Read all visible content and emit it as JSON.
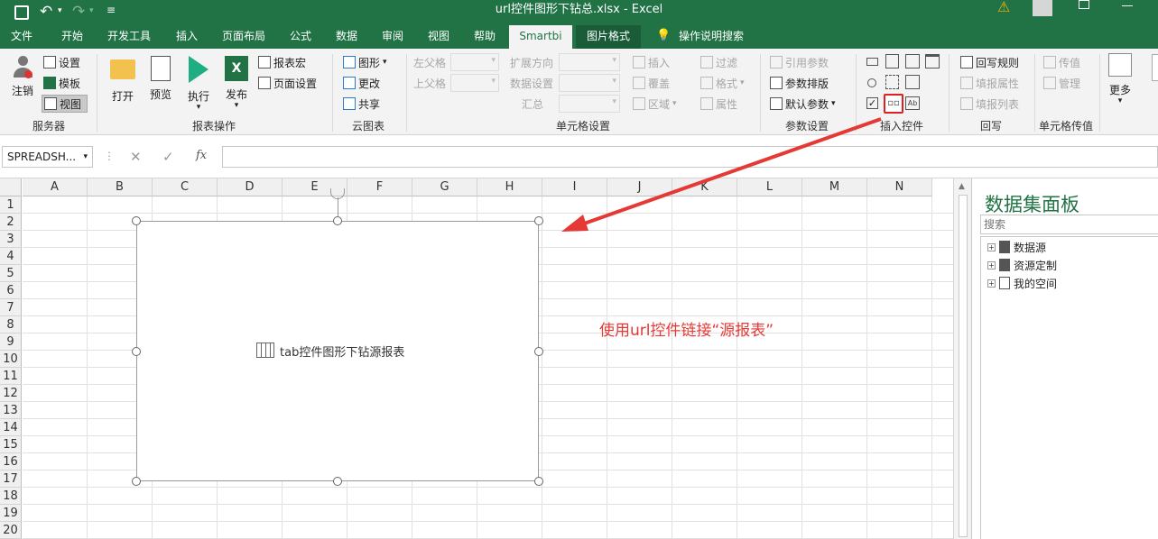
{
  "titlebar": {
    "title": "url控件图形下钻总.xlsx  -  Excel",
    "warning_icon": "warning-icon",
    "accent": "#217346"
  },
  "menu": [
    "文件",
    "开始",
    "开发工具",
    "插入",
    "页面布局",
    "公式",
    "数据",
    "审阅",
    "视图",
    "帮助",
    "Smartbi",
    "图片格式"
  ],
  "menu_search": "操作说明搜索",
  "ribbon": {
    "server": {
      "logout": "注销",
      "settings": "设置",
      "template": "模板",
      "view": "视图",
      "label": "服务器"
    },
    "report": {
      "open": "打开",
      "preview": "预览",
      "execute": "执行",
      "publish": "发布",
      "macro": "报表宏",
      "page_setup": "页面设置",
      "label": "报表操作"
    },
    "cloud": {
      "chart": "图形",
      "modify": "更改",
      "share": "共享",
      "label": "云图表"
    },
    "cell": {
      "left_parent": "左父格",
      "top_parent": "上父格",
      "expand_dir": "扩展方向",
      "data_setting": "数据设置",
      "summary": "汇总",
      "insert": "插入",
      "cover": "覆盖",
      "region": "区域",
      "filter": "过滤",
      "format": "格式",
      "property": "属性",
      "label": "单元格设置"
    },
    "param": {
      "ref": "引用参数",
      "layout": "参数排版",
      "default": "默认参数",
      "label": "参数设置"
    },
    "controls": {
      "label": "插入控件"
    },
    "writeback": {
      "rule": "回写规则",
      "fill_prop": "填报属性",
      "fill_list": "填报列表",
      "label": "回写"
    },
    "pass": {
      "value": "传值",
      "manage": "管理",
      "label": "单元格传值"
    },
    "more": "更多"
  },
  "formulabar": {
    "namebox": "SPREADSH...",
    "cancel": "✕",
    "confirm": "✓",
    "fx": "fx"
  },
  "sheet": {
    "columns": [
      "A",
      "B",
      "C",
      "D",
      "E",
      "F",
      "G",
      "H",
      "I",
      "J",
      "K",
      "L",
      "M",
      "N"
    ],
    "rows": [
      "1",
      "2",
      "3",
      "4",
      "5",
      "6",
      "7",
      "8",
      "9",
      "10",
      "11",
      "12",
      "13",
      "14",
      "15",
      "16",
      "17",
      "18",
      "19",
      "20"
    ],
    "control_label": "tab控件图形下钻源报表",
    "annotation": "使用url控件链接“源报表”",
    "annotation_color": "#e53935"
  },
  "panel": {
    "title": "数据集面板",
    "search_placeholder": "搜索",
    "tree": [
      "数据源",
      "资源定制",
      "我的空间"
    ]
  }
}
